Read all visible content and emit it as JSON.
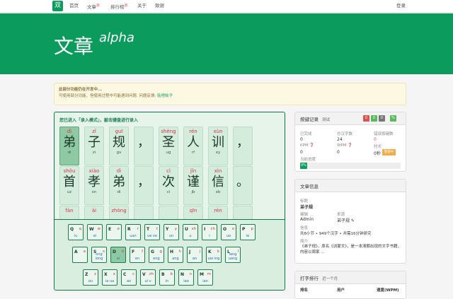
{
  "nav": {
    "logo": "双",
    "items": [
      {
        "label": "首页"
      },
      {
        "label": "文章",
        "tag": "测"
      },
      {
        "label": "排行榜",
        "tag": "测"
      },
      {
        "label": "关于"
      },
      {
        "label": "致谢"
      }
    ],
    "login": "登录"
  },
  "hero": {
    "title": "文章",
    "subtitle": "alpha"
  },
  "notice": {
    "title": "此部分功能仍在开发中...",
    "body": "可使用部分功能，但使用过程中可能遇到问题. 问题反馈: ",
    "link": "贴吧帖子"
  },
  "typing": {
    "hint": "您已进入「录入模式」，敲击键盘进行录入",
    "rows": [
      [
        {
          "py": "dì",
          "ch": "弟",
          "code": "di",
          "state": "done"
        },
        {
          "py": "zǐ",
          "ch": "子",
          "code": "zi",
          "state": "pending"
        },
        {
          "py": "guī",
          "ch": "规",
          "code": "gv",
          "state": "pending"
        },
        {
          "py": "",
          "ch": "，",
          "code": "",
          "state": "pending"
        },
        {
          "py": "shèng",
          "ch": "圣",
          "code": "ug",
          "state": "pending"
        },
        {
          "py": "rén",
          "ch": "人",
          "code": "rf",
          "state": "pending"
        },
        {
          "py": "xùn",
          "ch": "训",
          "code": "xy",
          "state": "pending"
        },
        {
          "py": "",
          "ch": "，",
          "code": "",
          "state": "pending"
        }
      ],
      [
        {
          "py": "shǒu",
          "ch": "首",
          "code": "uz",
          "state": "pending"
        },
        {
          "py": "xiào",
          "ch": "孝",
          "code": "xn",
          "state": "pending"
        },
        {
          "py": "dì",
          "ch": "弟",
          "code": "di",
          "state": "pending"
        },
        {
          "py": "",
          "ch": "，",
          "code": "",
          "state": "pending"
        },
        {
          "py": "cì",
          "ch": "次",
          "code": "ci",
          "state": "pending"
        },
        {
          "py": "jǐn",
          "ch": "谨",
          "code": "jb",
          "state": "pending"
        },
        {
          "py": "xìn",
          "ch": "信",
          "code": "xb",
          "state": "pending"
        },
        {
          "py": "",
          "ch": "。",
          "code": "",
          "state": "pending"
        }
      ],
      [
        {
          "py": "fàn",
          "ch": "",
          "code": "",
          "state": "pending"
        },
        {
          "py": "ài",
          "ch": "",
          "code": "",
          "state": "pending"
        },
        {
          "py": "zhòng",
          "ch": "",
          "code": "",
          "state": "pending"
        },
        {
          "py": "",
          "ch": "",
          "code": "",
          "state": "pending"
        },
        {
          "py": "",
          "ch": "",
          "code": "",
          "state": "pending"
        },
        {
          "py": "qīn",
          "ch": "",
          "code": "",
          "state": "pending"
        },
        {
          "py": "rén",
          "ch": "",
          "code": "",
          "state": "pending"
        },
        {
          "py": "",
          "ch": "",
          "code": "",
          "state": "pending"
        }
      ]
    ]
  },
  "keyboard": {
    "rows": [
      [
        {
          "k": "Q",
          "a": "q",
          "b": "iu"
        },
        {
          "k": "W",
          "a": "w",
          "b": "ei"
        },
        {
          "k": "E",
          "a": "e",
          "b": ""
        },
        {
          "k": "R",
          "a": "r",
          "b": "uan"
        },
        {
          "k": "T",
          "a": "t",
          "b": "ue ve"
        },
        {
          "k": "Y",
          "a": "y",
          "b": "un"
        },
        {
          "k": "U",
          "a": "sh",
          "b": "u"
        },
        {
          "k": "I",
          "a": "ch",
          "b": "i"
        },
        {
          "k": "O",
          "a": "o",
          "b": "uo"
        },
        {
          "k": "P",
          "a": "p",
          "b": "ie"
        }
      ],
      [
        {
          "k": "A",
          "a": "a",
          "b": ""
        },
        {
          "k": "S",
          "a": "s",
          "b": "ong iong"
        },
        {
          "k": "D",
          "a": "d",
          "b": "ai",
          "active": true
        },
        {
          "k": "F",
          "a": "f",
          "b": "en"
        },
        {
          "k": "G",
          "a": "g",
          "b": "eng"
        },
        {
          "k": "H",
          "a": "h",
          "b": "ang"
        },
        {
          "k": "J",
          "a": "j",
          "b": "an"
        },
        {
          "k": "K",
          "a": "k",
          "b": "uai ing"
        },
        {
          "k": "L",
          "a": "l",
          "b": "iang uang"
        }
      ],
      [
        {
          "k": "Z",
          "a": "z",
          "b": "ou"
        },
        {
          "k": "X",
          "a": "x",
          "b": "ia ua"
        },
        {
          "k": "C",
          "a": "c",
          "b": "ao"
        },
        {
          "k": "V",
          "a": "zh",
          "b": "ui v"
        },
        {
          "k": "B",
          "a": "b",
          "b": "in"
        },
        {
          "k": "N",
          "a": "n",
          "b": "iao"
        },
        {
          "k": "M",
          "a": "m",
          "b": "ian"
        }
      ]
    ]
  },
  "record": {
    "title": "按键记录",
    "sub": "测试",
    "badges": [
      {
        "t": "0",
        "color": "#d9534f"
      },
      {
        "t": "0",
        "color": "#5cb85c"
      },
      {
        "t": "0",
        "color": "#777777"
      },
      {
        "t": "%",
        "color": "#5cb85c"
      }
    ],
    "stats": [
      {
        "label": "已完成",
        "value": "0"
      },
      {
        "label": "总汉字数",
        "value": "24"
      },
      {
        "label": "错误按键数",
        "value": "0"
      },
      {
        "label": "KPM ❓",
        "value": "0"
      },
      {
        "label": "WPM ❓",
        "value": "0"
      },
      {
        "label": "时长",
        "value": "0秒"
      }
    ],
    "pause": "暂停中",
    "progress_label": "当前进度",
    "progress": "0%"
  },
  "info": {
    "title": "文章信息",
    "fields": [
      {
        "label": "标题",
        "value": "弟子规"
      },
      {
        "label": "编辑",
        "value": "Admin"
      },
      {
        "label": "来源",
        "value": "弟子规 ✎"
      },
      {
        "label": "信息",
        "value": "共8小节 • 949个汉字 • 共需16分钟研究"
      },
      {
        "label": "简介",
        "value": "《弟子规》，原名《训蒙文》，是一本清朝出现的文字书籍，内容以周家 ..."
      }
    ]
  },
  "rank": {
    "title": "打字排行",
    "sub": "近一个月",
    "cols": [
      "排名",
      "用户",
      "速度(WPM)"
    ]
  }
}
